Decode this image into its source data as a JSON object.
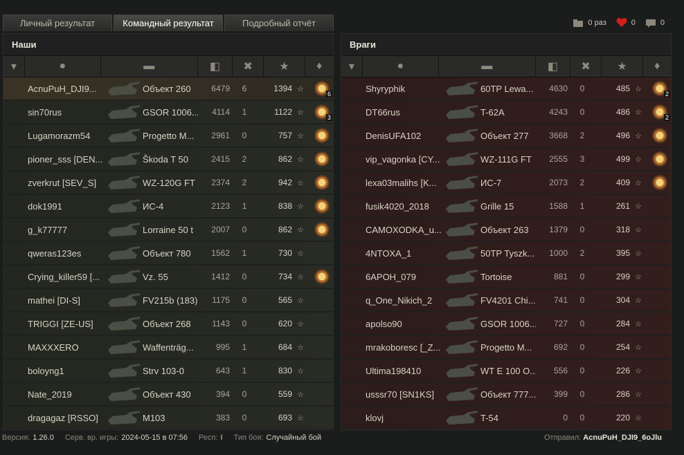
{
  "tabs": [
    "Личный результат",
    "Командный результат",
    "Подробный отчёт"
  ],
  "counters": {
    "folder": "0 раз",
    "hearts": "0",
    "comments": "0"
  },
  "allies": {
    "title": "Наши",
    "rows": [
      {
        "name": "AcnuPuH_DJI9...",
        "vehicle": "Объект 260",
        "dmg": "6479",
        "kills": "6",
        "xp": "1394",
        "medal": "6",
        "me": true
      },
      {
        "name": "sin70rus",
        "vehicle": "GSOR 1006...",
        "dmg": "4114",
        "kills": "1",
        "xp": "1122",
        "medal": "3"
      },
      {
        "name": "Lugamorazm54",
        "vehicle": "Progetto M...",
        "dmg": "2961",
        "kills": "0",
        "xp": "757",
        "medal": ""
      },
      {
        "name": "pioner_sss [DEN...",
        "vehicle": "Škoda T 50",
        "dmg": "2415",
        "kills": "2",
        "xp": "862",
        "medal": ""
      },
      {
        "name": "zverkrut [SEV_S]",
        "vehicle": "WZ-120G FT",
        "dmg": "2374",
        "kills": "2",
        "xp": "942",
        "medal": ""
      },
      {
        "name": "dok1991",
        "vehicle": "ИС-4",
        "dmg": "2123",
        "kills": "1",
        "xp": "838",
        "medal": ""
      },
      {
        "name": "g_k77777",
        "vehicle": "Lorraine 50 t",
        "dmg": "2007",
        "kills": "0",
        "xp": "862",
        "medal": ""
      },
      {
        "name": "qweras123es",
        "vehicle": "Объект 780",
        "dmg": "1562",
        "kills": "1",
        "xp": "730",
        "medal": null
      },
      {
        "name": "Crying_killer59 [...",
        "vehicle": "Vz. 55",
        "dmg": "1412",
        "kills": "0",
        "xp": "734",
        "medal": ""
      },
      {
        "name": "mathei [DI-S]",
        "vehicle": "FV215b (183)",
        "dmg": "1175",
        "kills": "0",
        "xp": "565",
        "medal": null
      },
      {
        "name": "TRIGGI [ZE-US]",
        "vehicle": "Объект 268",
        "dmg": "1143",
        "kills": "0",
        "xp": "620",
        "medal": null
      },
      {
        "name": "MAXXXERO",
        "vehicle": "Waffenträg...",
        "dmg": "995",
        "kills": "1",
        "xp": "684",
        "medal": null
      },
      {
        "name": "boloyng1",
        "vehicle": "Strv 103-0",
        "dmg": "643",
        "kills": "1",
        "xp": "830",
        "medal": null
      },
      {
        "name": "Nate_2019",
        "vehicle": "Объект 430",
        "dmg": "394",
        "kills": "0",
        "xp": "559",
        "medal": null
      },
      {
        "name": "dragagaz [RSSO]",
        "vehicle": "M103",
        "dmg": "383",
        "kills": "0",
        "xp": "693",
        "medal": null
      }
    ]
  },
  "enemies": {
    "title": "Враги",
    "rows": [
      {
        "name": "Shyryphik",
        "vehicle": "60TP Lewa...",
        "dmg": "4630",
        "kills": "0",
        "xp": "485",
        "medal": "2"
      },
      {
        "name": "DT66rus",
        "vehicle": "T-62A",
        "dmg": "4243",
        "kills": "0",
        "xp": "486",
        "medal": "2"
      },
      {
        "name": "DenisUFA102",
        "vehicle": "Объект 277",
        "dmg": "3668",
        "kills": "2",
        "xp": "496",
        "medal": ""
      },
      {
        "name": "vip_vagonka [CY...",
        "vehicle": "WZ-111G FT",
        "dmg": "2555",
        "kills": "3",
        "xp": "499",
        "medal": ""
      },
      {
        "name": "lexa03malihs [K...",
        "vehicle": "ИС-7",
        "dmg": "2073",
        "kills": "2",
        "xp": "409",
        "medal": ""
      },
      {
        "name": "fusik4020_2018",
        "vehicle": "Grille 15",
        "dmg": "1588",
        "kills": "1",
        "xp": "261",
        "medal": null
      },
      {
        "name": "CAMOXODKA_u...",
        "vehicle": "Объект 263",
        "dmg": "1379",
        "kills": "0",
        "xp": "318",
        "medal": null
      },
      {
        "name": "4NTOXA_1",
        "vehicle": "50TP Tyszk...",
        "dmg": "1000",
        "kills": "2",
        "xp": "395",
        "medal": null
      },
      {
        "name": "6APOH_079",
        "vehicle": "Tortoise",
        "dmg": "881",
        "kills": "0",
        "xp": "299",
        "medal": null
      },
      {
        "name": "q_One_Nikich_2",
        "vehicle": "FV4201 Chi...",
        "dmg": "741",
        "kills": "0",
        "xp": "304",
        "medal": null
      },
      {
        "name": "apolso90",
        "vehicle": "GSOR 1006...",
        "dmg": "727",
        "kills": "0",
        "xp": "284",
        "medal": null
      },
      {
        "name": "mrakoboresc [_Z...",
        "vehicle": "Progetto M...",
        "dmg": "692",
        "kills": "0",
        "xp": "254",
        "medal": null
      },
      {
        "name": "Ultima198410",
        "vehicle": "WT E 100 O...",
        "dmg": "556",
        "kills": "0",
        "xp": "226",
        "medal": null
      },
      {
        "name": "usssr70 [SN1KS]",
        "vehicle": "Объект 777...",
        "dmg": "399",
        "kills": "0",
        "xp": "286",
        "medal": null
      },
      {
        "name": "klovj",
        "vehicle": "T-54",
        "dmg": "0",
        "kills": "0",
        "xp": "220",
        "medal": null
      }
    ]
  },
  "footer": {
    "version_label": "Версия:",
    "version": "1.26.0",
    "server_label": "Серв. вр. игры:",
    "server_time": "2024-05-15 в 07:56",
    "resp_label": "Респ:",
    "resp": "I",
    "battle_label": "Тип боя:",
    "battle_type": "Случайный бой",
    "sender_label": "Отправил:",
    "sender": "AcnuPuH_DJI9_6oJlu"
  },
  "colors": {
    "ally_row": "#272a23",
    "enemy_row": "#311d1c",
    "own_row": "#3a3325"
  }
}
